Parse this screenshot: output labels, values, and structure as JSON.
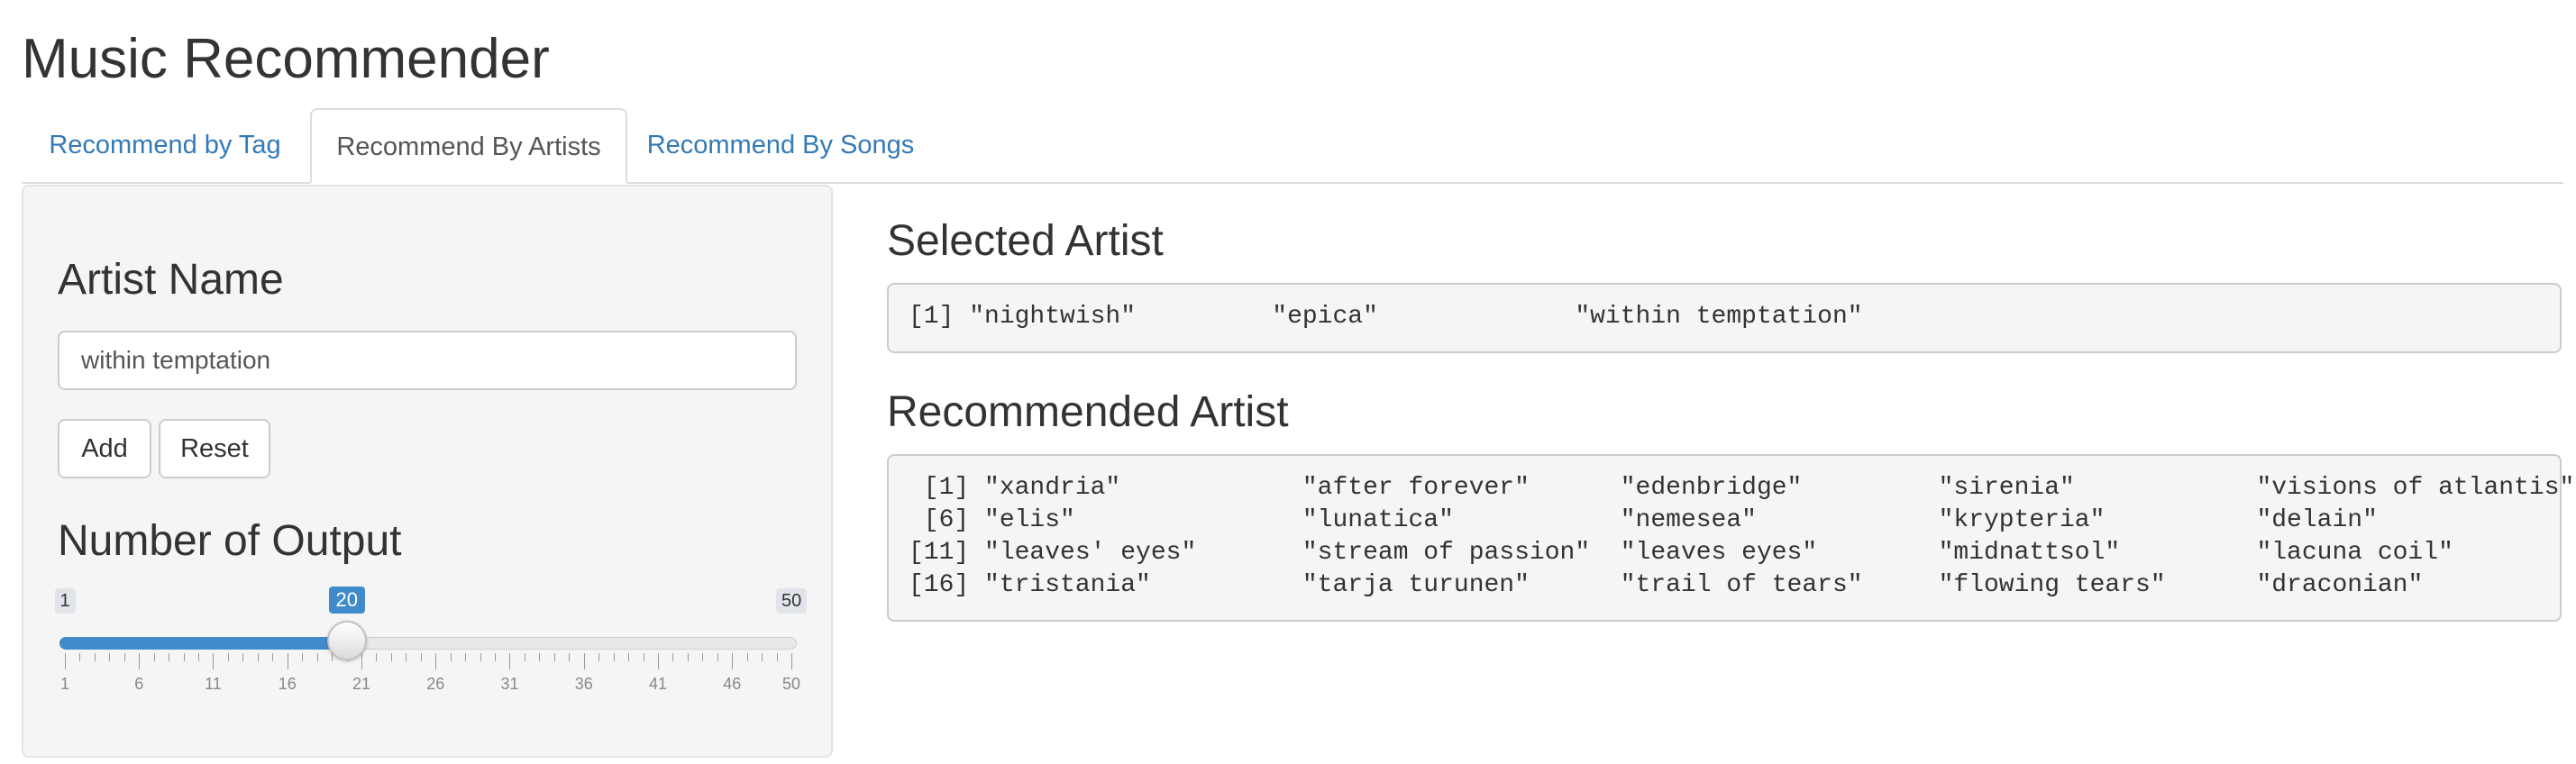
{
  "app": {
    "title": "Music Recommender"
  },
  "tabs": [
    {
      "label": "Recommend by Tag",
      "active": false
    },
    {
      "label": "Recommend By Artists",
      "active": true
    },
    {
      "label": "Recommend By Songs",
      "active": false
    }
  ],
  "sidebar": {
    "artist_heading": "Artist Name",
    "artist_input_value": "within temptation",
    "add_label": "Add",
    "reset_label": "Reset",
    "output_heading": "Number of Output",
    "slider": {
      "min": 1,
      "max": 50,
      "value": 20,
      "min_label": "1",
      "max_label": "50",
      "value_label": "20",
      "tick_labels": [
        "1",
        "6",
        "11",
        "16",
        "21",
        "26",
        "31",
        "36",
        "41",
        "46",
        "50"
      ]
    }
  },
  "main": {
    "selected_heading": "Selected Artist",
    "selected_output": "[1] \"nightwish\"         \"epica\"             \"within temptation\"",
    "recommended_heading": "Recommended Artist",
    "recommended_output": " [1] \"xandria\"            \"after forever\"      \"edenbridge\"         \"sirenia\"            \"visions of atlantis\"\n [6] \"elis\"               \"lunatica\"           \"nemesea\"            \"krypteria\"          \"delain\"\n[11] \"leaves' eyes\"       \"stream of passion\"  \"leaves eyes\"        \"midnattsol\"         \"lacuna coil\"\n[16] \"tristania\"          \"tarja turunen\"      \"trail of tears\"     \"flowing tears\"      \"draconian\""
  },
  "colors": {
    "link": "#337ab7",
    "slider_accent": "#428bca",
    "panel_bg": "#f5f5f5"
  }
}
